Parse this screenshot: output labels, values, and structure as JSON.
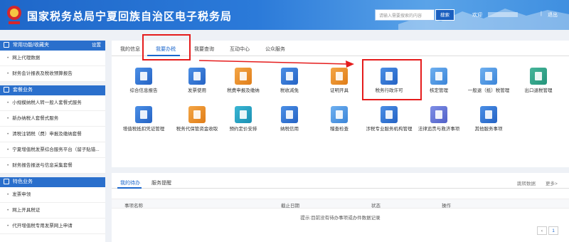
{
  "header": {
    "site_title": "国家税务总局宁夏回族自治区电子税务局",
    "search_placeholder": "请输入需要搜索的内容",
    "search_button": "搜索",
    "welcome": "欢迎",
    "separator": "|",
    "logout": "退出",
    "brand_color": "#2b7ad9"
  },
  "sidebar": {
    "sections": [
      {
        "title": "常用功能/收藏夹",
        "action": "设置",
        "items": [
          "网上代理数据",
          "财务会计报表及税收预算报告"
        ]
      },
      {
        "title": "套餐业务",
        "items": [
          "小规模纳税人转一般人套餐式服务",
          "新办纳税人套餐式服务",
          "清税注销税（费）申报及缴纳套餐",
          "宁夏增值税发票综合服务平台（留子贴错...",
          "财务报告报送与信息采集套餐"
        ]
      },
      {
        "title": "特色业务",
        "items": [
          "发票申领",
          "网上开具税证",
          "代开增值税专用发票网上申请"
        ]
      }
    ]
  },
  "main": {
    "tabs": [
      "我的信息",
      "我要办税",
      "我要查询",
      "互动中心",
      "公众服务"
    ],
    "active_tab": "我要办税",
    "services": [
      {
        "label": "综合信息报告",
        "icon": "report-icon"
      },
      {
        "label": "发票使用",
        "icon": "invoice-icon"
      },
      {
        "label": "税费申报及缴纳",
        "icon": "declare-pay-icon"
      },
      {
        "label": "税收减免",
        "icon": "tax-reduction-icon"
      },
      {
        "label": "证明开具",
        "icon": "certificate-icon"
      },
      {
        "label": "税务行政许可",
        "icon": "license-icon"
      },
      {
        "label": "核定管理",
        "icon": "assessment-icon"
      },
      {
        "label": "一般退（抵）税管理",
        "icon": "refund-icon"
      },
      {
        "label": "出口退税管理",
        "icon": "export-refund-icon"
      },
      {
        "label": "增值税抵扣凭证管理",
        "icon": "vat-voucher-icon"
      },
      {
        "label": "税务代保管资金收取",
        "icon": "custody-fund-icon"
      },
      {
        "label": "预约定价安排",
        "icon": "pricing-arrangement-icon"
      },
      {
        "label": "纳税信用",
        "icon": "credit-icon"
      },
      {
        "label": "稽查检查",
        "icon": "inspection-icon"
      },
      {
        "label": "涉税专业服务机构管理",
        "icon": "agency-icon"
      },
      {
        "label": "法律追责与救济事项",
        "icon": "legal-icon"
      },
      {
        "label": "其他服务事项",
        "icon": "other-services-icon"
      }
    ]
  },
  "bottom": {
    "tabs": [
      "我的待办",
      "服务提醒"
    ],
    "right_links": [
      "跳转数据",
      "更多>"
    ],
    "columns": [
      "事项名称",
      "截止日期",
      "状态",
      "操作"
    ],
    "empty_text": "提示:目前没有待办事项或办件数据记录",
    "page": "1"
  }
}
